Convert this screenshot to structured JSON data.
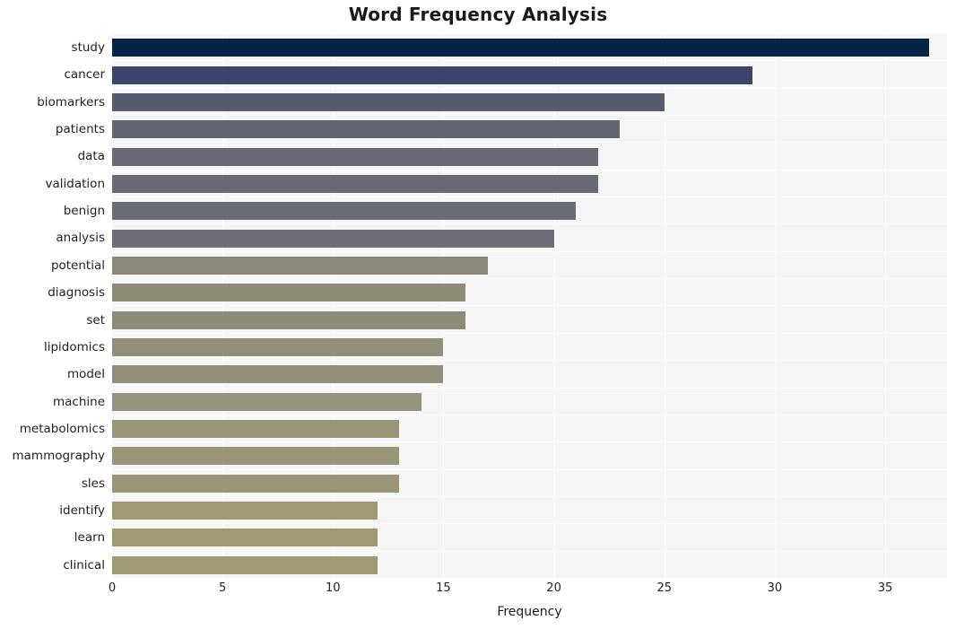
{
  "chart_data": {
    "type": "bar",
    "orientation": "horizontal",
    "title": "Word Frequency Analysis",
    "xlabel": "Frequency",
    "ylabel": "",
    "xlim": [
      0,
      37.8
    ],
    "xticks": [
      0,
      5,
      10,
      15,
      20,
      25,
      30,
      35
    ],
    "xticklabels": [
      "0",
      "5",
      "10",
      "15",
      "20",
      "25",
      "30",
      "35"
    ],
    "grid": true,
    "grid_axis": "x",
    "legend": false,
    "categories": [
      "study",
      "cancer",
      "biomarkers",
      "patients",
      "data",
      "validation",
      "benign",
      "analysis",
      "potential",
      "diagnosis",
      "set",
      "lipidomics",
      "model",
      "machine",
      "metabolomics",
      "mammography",
      "sles",
      "identify",
      "learn",
      "clinical"
    ],
    "values": [
      37,
      29,
      25,
      23,
      22,
      22,
      21,
      20,
      17,
      16,
      16,
      15,
      15,
      14,
      13,
      13,
      13,
      12,
      12,
      12
    ],
    "bar_colors": [
      "#06234a",
      "#3a456b",
      "#555a6e",
      "#636673",
      "#676a75",
      "#676a75",
      "#6a6c76",
      "#6d6e77",
      "#8b8878",
      "#8f8b79",
      "#8f8b79",
      "#938e7a",
      "#938e7a",
      "#97927a",
      "#9b9578",
      "#9b9578",
      "#9b9578",
      "#a09a74",
      "#a09a74",
      "#a09a74"
    ],
    "plot_bg": "#f6f6f7",
    "figure_bg": "#ffffff",
    "grid_color": "#ffffff"
  }
}
